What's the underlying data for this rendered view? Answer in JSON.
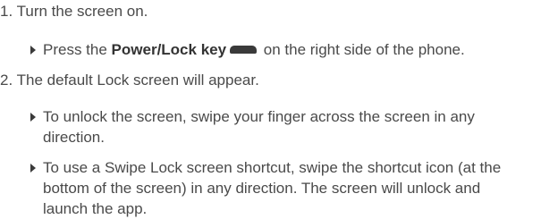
{
  "steps": [
    {
      "number": "1.",
      "text": "Turn the screen on.",
      "bullets": [
        {
          "prefix": "Press the ",
          "bold": "Power/Lock key",
          "icon": "power-lock-key-icon",
          "suffix": " on the right side of the phone."
        }
      ]
    },
    {
      "number": "2.",
      "text": "The default Lock screen will appear.",
      "bullets": [
        {
          "text_line1": "To unlock the screen, swipe your finger across the screen in any",
          "text_line2": "direction."
        },
        {
          "text_line1": "To use a Swipe Lock screen shortcut, swipe the shortcut icon (at the",
          "text_line2": "bottom of the screen) in any direction. The screen will unlock and",
          "text_line3": "launch the app."
        }
      ]
    }
  ]
}
